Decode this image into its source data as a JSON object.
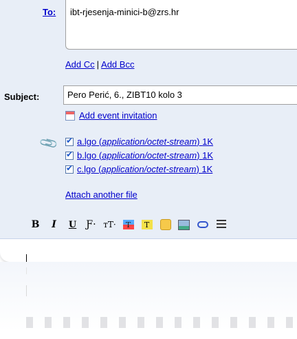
{
  "to": {
    "label": "To:",
    "value": "ibt-rjesenja-minici-b@zrs.hr"
  },
  "cc": {
    "add_cc": "Add Cc",
    "separator": "|",
    "add_bcc": "Add Bcc"
  },
  "subject": {
    "label": "Subject:",
    "value": "Pero Perić, 6., ZIBT10 kolo 3"
  },
  "event": {
    "label": "Add event invitation",
    "icon": "calendar-icon"
  },
  "attachments": [
    {
      "name": "a.lgo",
      "type": "application/octet-stream",
      "size": "1K"
    },
    {
      "name": "b.lgo",
      "type": "application/octet-stream",
      "size": "1K"
    },
    {
      "name": "c.lgo",
      "type": "application/octet-stream",
      "size": "1K"
    }
  ],
  "attach_another": "Attach another file",
  "toolbar": {
    "bold": "B",
    "italic": "I",
    "underline": "U",
    "font": "Ƒ·",
    "size": "тT·",
    "text_color": "T",
    "highlight": "T"
  },
  "colors": {
    "panel": "#e8eef7",
    "link": "#0000cc"
  }
}
